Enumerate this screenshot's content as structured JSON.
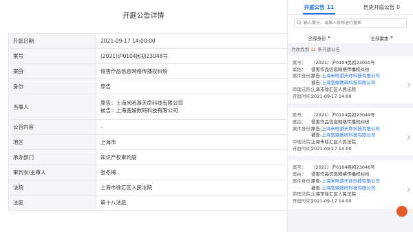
{
  "detail": {
    "title": "开庭公告详情",
    "rows": [
      {
        "label": "开庭日期",
        "values": [
          "2021-09-17 14:00:00"
        ]
      },
      {
        "label": "案号",
        "values": [
          "(2021)沪0104民初23048号"
        ]
      },
      {
        "label": "案由",
        "values": [
          "侵害作品信息网络传播权纠纷"
        ]
      },
      {
        "label": "身份",
        "values": [
          "原告"
        ]
      },
      {
        "label": "当事人",
        "values": [
          "原告：上海米哈游天命科技有限公司",
          "被告：上海宽娱数码科技有限公司"
        ]
      },
      {
        "label": "公告内容",
        "values": [
          "-"
        ]
      },
      {
        "label": "地区",
        "values": [
          "上海市"
        ]
      },
      {
        "label": "承办部门",
        "values": [
          "知识产权审判庭"
        ]
      },
      {
        "label": "审判长/主审人",
        "values": [
          "张冬梅"
        ]
      },
      {
        "label": "法院",
        "values": [
          "上海市徐汇区人民法院"
        ]
      },
      {
        "label": "法庭",
        "values": [
          "第十八法庭"
        ]
      }
    ]
  },
  "panel": {
    "tabs": [
      {
        "label": "开庭公告",
        "count": "11",
        "active": true
      },
      {
        "label": "历史开庭公告",
        "count": "0",
        "active": false
      }
    ],
    "search_placeholder": "输入案号、当事人名称进行搜索",
    "filters": [
      "全部身份",
      "全部案由"
    ],
    "found": {
      "prefix": "为你找到",
      "count": "11",
      "suffix": "条开庭公告"
    },
    "card_labels": {
      "case_no": "案号：",
      "cause": "案由：",
      "role": "案件身份：",
      "court": "审理法院：",
      "time": "开庭时间："
    },
    "cards": [
      {
        "case_no": "（2021）沪0104民初23050号",
        "cause": "侵害作品信息网络传播权纠纷",
        "plaintiff_prefix": "原告-",
        "plaintiff": "上海米哈游天命科技有限公司",
        "defendant_prefix": "被告-",
        "defendant": "上海宽娱数码科技有限公司",
        "court": "上海市徐汇区人民法院",
        "time": "2021-09-17 14:00"
      },
      {
        "case_no": "（2021）沪0104民初23049号",
        "cause": "侵害作品信息网络传播权纠纷",
        "plaintiff_prefix": "原告-",
        "plaintiff": "上海米哈游天命科技有限公司",
        "defendant_prefix": "被告-",
        "defendant": "上海宽娱数码科技有限公司",
        "court": "上海市徐汇区人民法院",
        "time": "2021-09-17 14:00"
      },
      {
        "case_no": "（2021）沪0104民初23046号",
        "cause": "侵害作品信息网络传播权纠纷",
        "plaintiff_prefix": "原告-",
        "plaintiff": "上海米哈游天命科技有限公司",
        "defendant_prefix": "被告-",
        "defendant": "上海宽娱数码科技有限公司",
        "court": "上海市徐汇区人民法院",
        "time": "2021-09-17 14:00"
      }
    ]
  },
  "colors": {
    "accent": "#1f6fe8",
    "count_red": "#e84a3a",
    "label_bg": "#f4f6f9",
    "panel_bg": "#f3f4f7"
  }
}
